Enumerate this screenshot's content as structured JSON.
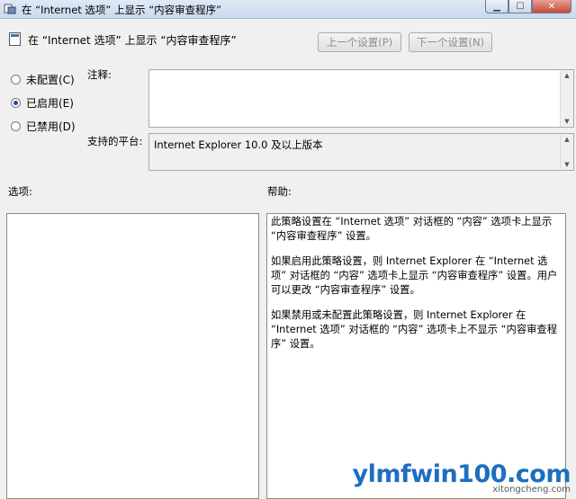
{
  "window": {
    "title": "在 “Internet 选项” 上显示 “内容审查程序”"
  },
  "header": {
    "title": "在 “Internet 选项” 上显示 “内容审查程序”",
    "prev_button": "上一个设置(P)",
    "next_button": "下一个设置(N)"
  },
  "radios": [
    {
      "label": "未配置(C)",
      "checked": false
    },
    {
      "label": "已启用(E)",
      "checked": true
    },
    {
      "label": "已禁用(D)",
      "checked": false
    }
  ],
  "comment": {
    "label": "注释:",
    "value": ""
  },
  "platform": {
    "label": "支持的平台:",
    "value": "Internet Explorer 10.0 及以上版本"
  },
  "options": {
    "label": "选项:"
  },
  "help": {
    "label": "帮助:",
    "paragraphs": [
      "此策略设置在 “Internet 选项” 对话框的 “内容” 选项卡上显示 “内容审查程序” 设置。",
      "如果启用此策略设置，则 Internet Explorer 在 “Internet 选项” 对话框的 “内容” 选项卡上显示 “内容审查程序” 设置。用户可以更改 “内容审查程序” 设置。",
      "如果禁用或未配置此策略设置，则 Internet Explorer 在 “Internet 选项” 对话框的 “内容” 选项卡上不显示 “内容审查程序” 设置。"
    ]
  },
  "watermark": {
    "main": "ylmfwin100.com",
    "sub": "xitongcheng.com"
  }
}
